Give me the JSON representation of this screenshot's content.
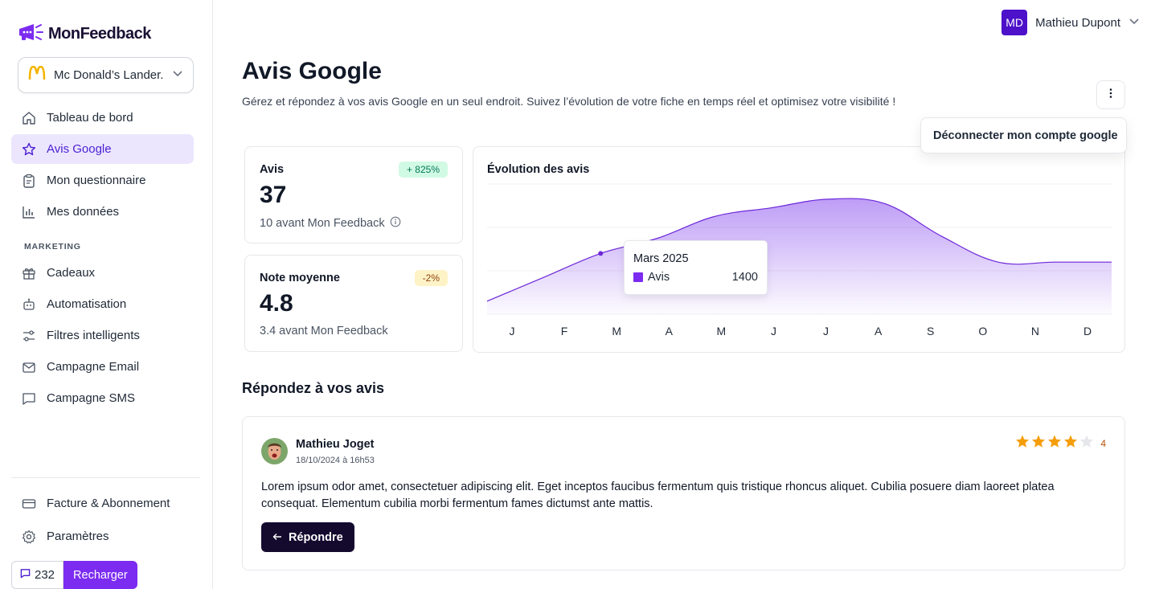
{
  "brand": {
    "name": "MonFeedback"
  },
  "store_selector": {
    "value": "Mc Donald’s Lander..."
  },
  "nav": {
    "main": [
      {
        "label": "Tableau de bord",
        "icon": "home-icon"
      },
      {
        "label": "Avis Google",
        "icon": "star-icon"
      },
      {
        "label": "Mon questionnaire",
        "icon": "clipboard-icon"
      },
      {
        "label": "Mes données",
        "icon": "bar-chart-icon"
      }
    ],
    "section_label": "MARKETING",
    "marketing": [
      {
        "label": "Cadeaux",
        "icon": "gift-icon"
      },
      {
        "label": "Automatisation",
        "icon": "bot-icon"
      },
      {
        "label": "Filtres intelligents",
        "icon": "filter-icon"
      },
      {
        "label": "Campagne Email",
        "icon": "mail-icon"
      },
      {
        "label": "Campagne SMS",
        "icon": "message-icon"
      }
    ],
    "bottom": [
      {
        "label": "Facture & Abonnement",
        "icon": "credit-card-icon"
      },
      {
        "label": "Paramètres",
        "icon": "gear-icon"
      }
    ]
  },
  "credits": {
    "count": "232",
    "recharge_label": "Recharger"
  },
  "user": {
    "initials": "MD",
    "name": "Mathieu Dupont"
  },
  "header": {
    "title": "Avis Google",
    "subtitle": "Gérez et répondez à vos avis Google en un seul endroit. Suivez l’évolution de votre fiche en temps réel et optimisez votre visibilité !"
  },
  "menu": {
    "disconnect_label": "Déconnecter mon compte google"
  },
  "stats": {
    "reviews": {
      "label": "Avis",
      "badge": "+ 825%",
      "value": "37",
      "sub": "10 avant Mon Feedback"
    },
    "rating": {
      "label": "Note moyenne",
      "badge": "-2%",
      "value": "4.8",
      "sub": "3.4 avant Mon Feedback"
    }
  },
  "colors": {
    "accent": "#7c2cf0",
    "active_bg": "#ebe6fe",
    "badge_up_bg": "#d1fae5",
    "badge_up_fg": "#047857",
    "badge_down_bg": "#fef3c7",
    "badge_down_fg": "#92400e",
    "star": "#f59e0b"
  },
  "chart_data": {
    "type": "area",
    "title": "Évolution des avis",
    "categories": [
      "J",
      "F",
      "M",
      "A",
      "M",
      "J",
      "J",
      "A",
      "S",
      "O",
      "N",
      "D"
    ],
    "series": [
      {
        "name": "Avis",
        "values": [
          300,
          850,
          1400,
          1750,
          2250,
          2450,
          2650,
          2550,
          1800,
          1200,
          1200,
          1200
        ]
      }
    ],
    "ylim": [
      0,
      3000
    ],
    "grid": true,
    "tooltip": {
      "title": "Mars 2025",
      "series": "Avis",
      "value": "1400",
      "index": 2
    }
  },
  "reviews_section": {
    "title": "Répondez à vos avis",
    "items": [
      {
        "name": "Mathieu Joget",
        "date": "18/10/2024 à 16h53",
        "rating": 4,
        "rating_label": "4",
        "text": "Lorem ipsum odor amet, consectetuer adipiscing elit. Eget inceptos faucibus fermentum quis tristique rhoncus aliquet. Cubilia posuere diam laoreet platea consequat. Elementum cubilia morbi fermentum fames dictumst ante mattis.",
        "reply_label": "Répondre"
      }
    ]
  }
}
